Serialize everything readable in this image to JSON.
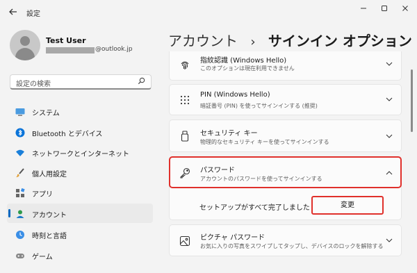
{
  "titlebar": {
    "title": "設定",
    "back_icon": "arrow-left-icon"
  },
  "profile": {
    "name": "Test User",
    "email_domain": "@outlook.jp"
  },
  "search": {
    "placeholder": "設定の検索"
  },
  "sidebar": {
    "items": [
      {
        "label": "システム",
        "icon": "monitor-icon"
      },
      {
        "label": "Bluetooth とデバイス",
        "icon": "bluetooth-icon"
      },
      {
        "label": "ネットワークとインターネット",
        "icon": "wifi-icon"
      },
      {
        "label": "個人用設定",
        "icon": "paintbrush-icon"
      },
      {
        "label": "アプリ",
        "icon": "apps-icon"
      },
      {
        "label": "アカウント",
        "icon": "person-icon",
        "active": true
      },
      {
        "label": "時刻と言語",
        "icon": "globe-clock-icon"
      },
      {
        "label": "ゲーム",
        "icon": "gamepad-icon"
      }
    ]
  },
  "header": {
    "crumb": "アカウント",
    "separator": "›",
    "current": "サインイン オプション"
  },
  "options": [
    {
      "title": "指紋認識 (Windows Hello)",
      "desc": "このオプションは現在利用できません",
      "icon": "fingerprint-icon",
      "state": "collapsed"
    },
    {
      "title": "PIN (Windows Hello)",
      "desc": "暗証番号 (PIN) を使ってサインインする (推奨)",
      "icon": "pin-keypad-icon",
      "state": "collapsed"
    },
    {
      "title": "セキュリティ キー",
      "desc": "物理的なセキュリティ キーを使ってサインインする",
      "icon": "usb-key-icon",
      "state": "collapsed"
    },
    {
      "title": "パスワード",
      "desc": "アカウントのパスワードを使ってサインインする",
      "icon": "key-icon",
      "state": "expanded"
    },
    {
      "title": "ピクチャ パスワード",
      "desc": "お気に入りの写真をスワイプしてタップし、デバイスのロックを解除する",
      "icon": "picture-icon",
      "state": "collapsed"
    }
  ],
  "password_panel": {
    "status": "セットアップがすべて完了しました",
    "change_label": "変更"
  },
  "colors": {
    "accent": "#0067c0",
    "highlight": "#e0302b"
  }
}
